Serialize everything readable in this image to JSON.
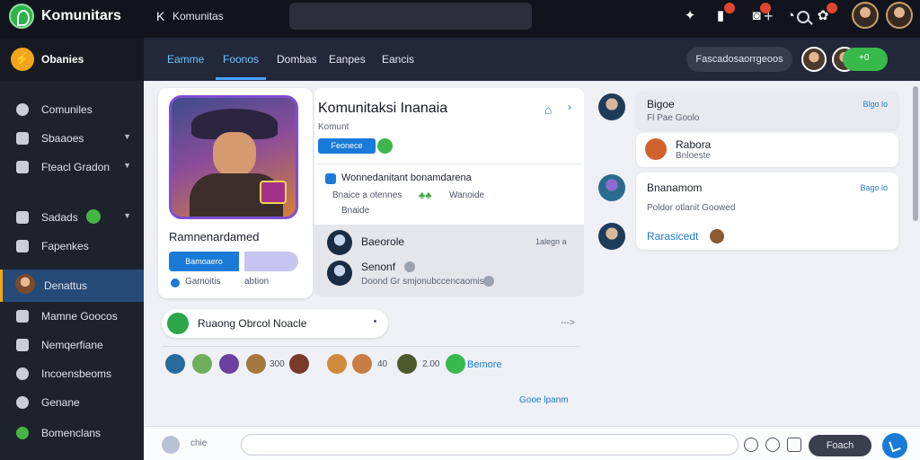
{
  "topbar": {
    "app_title": "Komunitars",
    "crumb": "Komunitas",
    "icons": [
      "puzzle-icon",
      "bookmark-icon",
      "bell-icon",
      "chat-icon",
      "settings-icon"
    ]
  },
  "sidebar": {
    "header": "Obanies",
    "items": [
      {
        "label": "Comuniles",
        "icon": "gear-icon"
      },
      {
        "label": "Sbaaoes",
        "icon": "folder-icon"
      },
      {
        "label": "Fteacl Gradon",
        "icon": "code-icon"
      },
      {
        "label": "Sadads",
        "icon": "edit-icon"
      },
      {
        "label": "Fapenkes",
        "icon": "list-icon"
      },
      {
        "label": "Denattus",
        "icon": "user-avatar",
        "active": true
      },
      {
        "label": "Mamne Goocos",
        "icon": "mail-icon"
      },
      {
        "label": "Nemqerfiane",
        "icon": "chart-icon"
      },
      {
        "label": "Incoensbeoms",
        "icon": "clock-icon"
      },
      {
        "label": "Genane",
        "icon": "circle-icon"
      },
      {
        "label": "Bomenclans",
        "icon": "green-circle-icon"
      }
    ]
  },
  "tabs": [
    "Eamme",
    "Foonos",
    "Dombas",
    "Eanpes",
    "Eancis"
  ],
  "tabbar": {
    "status_pill": "Fascadosaorrgeoos",
    "green_pill": "+0"
  },
  "profile": {
    "name": "Ramnenardamed",
    "primary_button": "Bamoaero",
    "meta_a": "Gamoitis",
    "meta_b": "abtion"
  },
  "community": {
    "title": "Komunitaksi Inanaia",
    "subtitle": "Komunt",
    "chip": "Feonece",
    "announcement": {
      "title": "Wonnedanitant bonamdarena",
      "line1": "Bnaice a otennes",
      "line2": "Wanoide",
      "line3": "Bnaide"
    },
    "feed": [
      {
        "name": "Baeorole",
        "time": "1alegn a"
      },
      {
        "name": "Senonf",
        "time": ""
      }
    ],
    "feed_msg": "Doond Gr smjonubccencaomis"
  },
  "reply": {
    "text": "Ruaong Obrcol Noacle",
    "arrow": "--->"
  },
  "members": {
    "counts": [
      "300",
      "40",
      "2.00"
    ],
    "link": "Bemore"
  },
  "see_all": "Gooe lpanm",
  "chat": [
    {
      "name": "Bigoe",
      "time": "Blgo lo",
      "sub": "Fl Pae Goolo"
    },
    {
      "name": "Rabora",
      "time": "",
      "sub": "Bnloeste"
    },
    {
      "name": "Bnanamom",
      "time": "Bago lo",
      "sub": "Poldor otlanit Goowed"
    },
    {
      "name": "Rarasicedt",
      "time": "",
      "sub": ""
    }
  ],
  "composer": {
    "label": "chie",
    "send_label": "Foach"
  },
  "colors": {
    "accent": "#1a7ad8",
    "brand_green": "#38b94c",
    "sidebar_bg": "#1e222d",
    "topbar_bg": "#11141c"
  }
}
